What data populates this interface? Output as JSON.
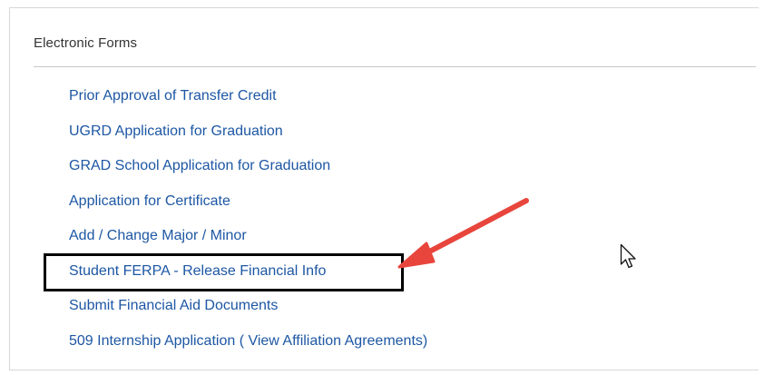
{
  "panel": {
    "title": "Electronic Forms"
  },
  "links": [
    {
      "label": "Prior Approval of Transfer Credit"
    },
    {
      "label": "UGRD Application for Graduation"
    },
    {
      "label": "GRAD School Application for Graduation"
    },
    {
      "label": "Application for Certificate"
    },
    {
      "label": "Add / Change Major / Minor"
    },
    {
      "label": "Student FERPA - Release Financial Info"
    },
    {
      "label": "Submit Financial Aid Documents"
    },
    {
      "label": "509 Internship Application",
      "paren_open": " ( ",
      "sub_label": "View Affiliation Agreements",
      "paren_close": ")"
    }
  ],
  "colors": {
    "link": "#1d57a4",
    "annotation_arrow": "#e8453c",
    "highlight_box": "#000000"
  },
  "icons": {
    "arrow": "red-annotation-arrow-icon",
    "cursor": "mouse-pointer-icon"
  }
}
